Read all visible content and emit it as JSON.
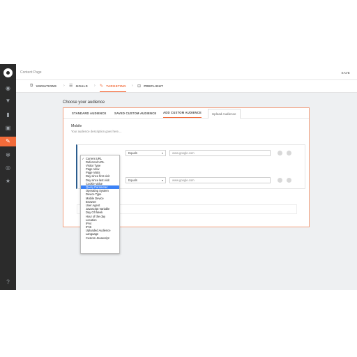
{
  "header": {
    "page_title": "Content Page",
    "save_label": "SAVE"
  },
  "steps": [
    {
      "label": "VARIATIONS",
      "icon": "variations-icon"
    },
    {
      "label": "GOALS",
      "icon": "goals-icon"
    },
    {
      "label": "TARGETING",
      "icon": "targeting-icon",
      "active": true
    },
    {
      "label": "PREFLIGHT",
      "icon": "preflight-icon"
    }
  ],
  "main": {
    "heading": "Choose your audience",
    "tabs": [
      "STANDARD AUDIENCE",
      "SAVED CUSTOM AUDIENCE",
      "ADD CUSTOM AUDIENCE",
      "Upload Audience"
    ],
    "active_tab": "ADD CUSTOM AUDIENCE",
    "audience_name": "Mobile",
    "audience_description": "Your audience description goes here....",
    "rules": [
      {
        "operator": "Equals",
        "placeholder": "www.google.com"
      },
      {
        "operator": "Equals",
        "placeholder": "www.google.com"
      }
    ]
  },
  "dropdown": {
    "selected": "Current URL",
    "highlighted": "Query Parameter",
    "options": [
      "Current URL",
      "Referrerd URL",
      "Visitor Type",
      "Page View",
      "Page Visits",
      "Day since first visit",
      "Day since last visit",
      "Cookie Value",
      "Query Parameter",
      "Operating System",
      "Device Type",
      "Mobile Device",
      "Browser",
      "User Agent",
      "Javascript Variable",
      "Day Of Week",
      "Hour of the day",
      "Location",
      "IPv4",
      "IPv6",
      "Uploaded Audience",
      "Language",
      "Custom Javascript"
    ]
  },
  "colors": {
    "accent": "#f26b3a",
    "sidebar": "#2b2b2b",
    "highlight": "#3b82f6"
  }
}
